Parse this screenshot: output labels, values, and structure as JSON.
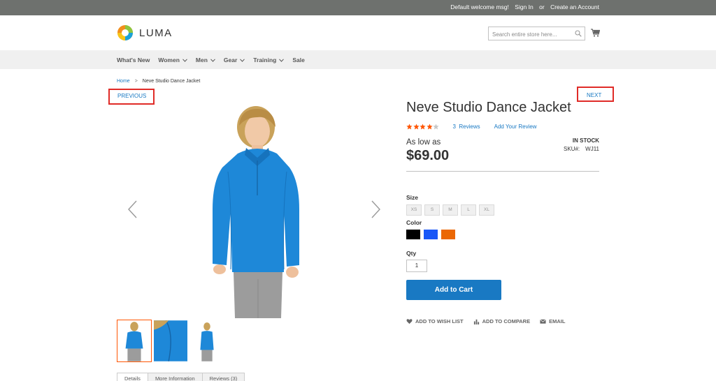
{
  "top_panel": {
    "welcome": "Default welcome msg!",
    "sign_in": "Sign In",
    "or": "or",
    "create_account": "Create an Account"
  },
  "header": {
    "logo_text": "LUMA",
    "search_placeholder": "Search entire store here..."
  },
  "nav": {
    "items": [
      "What's New",
      "Women",
      "Men",
      "Gear",
      "Training",
      "Sale"
    ]
  },
  "breadcrumb": {
    "home": "Home",
    "separator": ">",
    "current": "Neve Studio Dance Jacket"
  },
  "pager": {
    "previous": "PREVIOUS",
    "next": "NEXT"
  },
  "product": {
    "title": "Neve Studio Dance Jacket",
    "rating_stars": 4,
    "rating_max": 5,
    "reviews_count": "3",
    "reviews_label": "Reviews",
    "add_review": "Add Your Review",
    "as_low_as": "As low as",
    "price": "$69.00",
    "stock": "IN STOCK",
    "sku_label": "SKU#:",
    "sku_value": "WJ11",
    "size_label": "Size",
    "sizes": [
      "XS",
      "S",
      "M",
      "L",
      "XL"
    ],
    "color_label": "Color",
    "colors": [
      "#000000",
      "#1857f7",
      "#eb6703"
    ],
    "qty_label": "Qty",
    "qty_value": "1",
    "add_to_cart": "Add to Cart",
    "wishlist": "ADD TO WISH LIST",
    "compare": "ADD TO COMPARE",
    "email": "EMAIL"
  },
  "tabs": [
    "Details",
    "More Information",
    "Reviews (3)"
  ],
  "colors": {
    "accent_blue": "#1979c3",
    "highlight_red": "#e02b27",
    "thumb_active": "#ff5501",
    "jacket_blue": "#1e88d8"
  }
}
